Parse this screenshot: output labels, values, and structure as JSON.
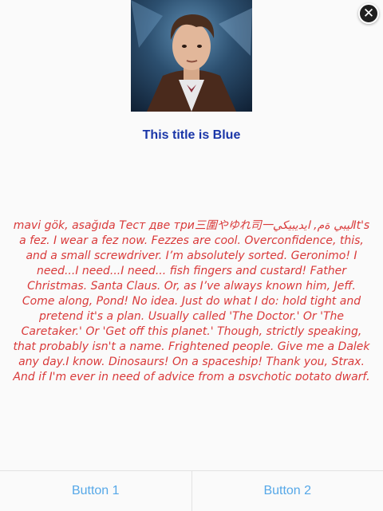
{
  "dialog": {
    "title": "This title is Blue",
    "message": "mavi gök, asağıda Тест две три三圍やゆれ司一ليبي ةم, ايديبيكيIt's a fez. I wear a fez now. Fezzes are cool. Overconfidence, this, and a small screwdriver. I’m absolutely sorted. Geronimo! I need...I need...I need... fish fingers and custard! Father Christmas. Santa Claus. Or, as I’ve always known him, Jeff. Come along, Pond! No idea. Just do what I do: hold tight and pretend it's a plan. Usually called 'The Doctor.' Or 'The Caretaker.' Or 'Get off this planet.' Though, strictly speaking, that probably isn't a name. Frightened people. Give me a Dalek any day.I know. Dinosaurs! On a spaceship! Thank you, Strax. And if I'm ever in need of advice from a psychotic potato dwarf, you'll certainly be the first to know. Please tell me I didn't get old. Anything but old. I was young! Oh... is he grey? Bow ties are cool.",
    "close_icon": "close-icon",
    "image_icon": "portrait-image"
  },
  "buttons": {
    "button1": "Button 1",
    "button2": "Button 2"
  },
  "colors": {
    "title": "#1a36a8",
    "message": "#d93a3a",
    "button_text": "#56a8e8"
  }
}
